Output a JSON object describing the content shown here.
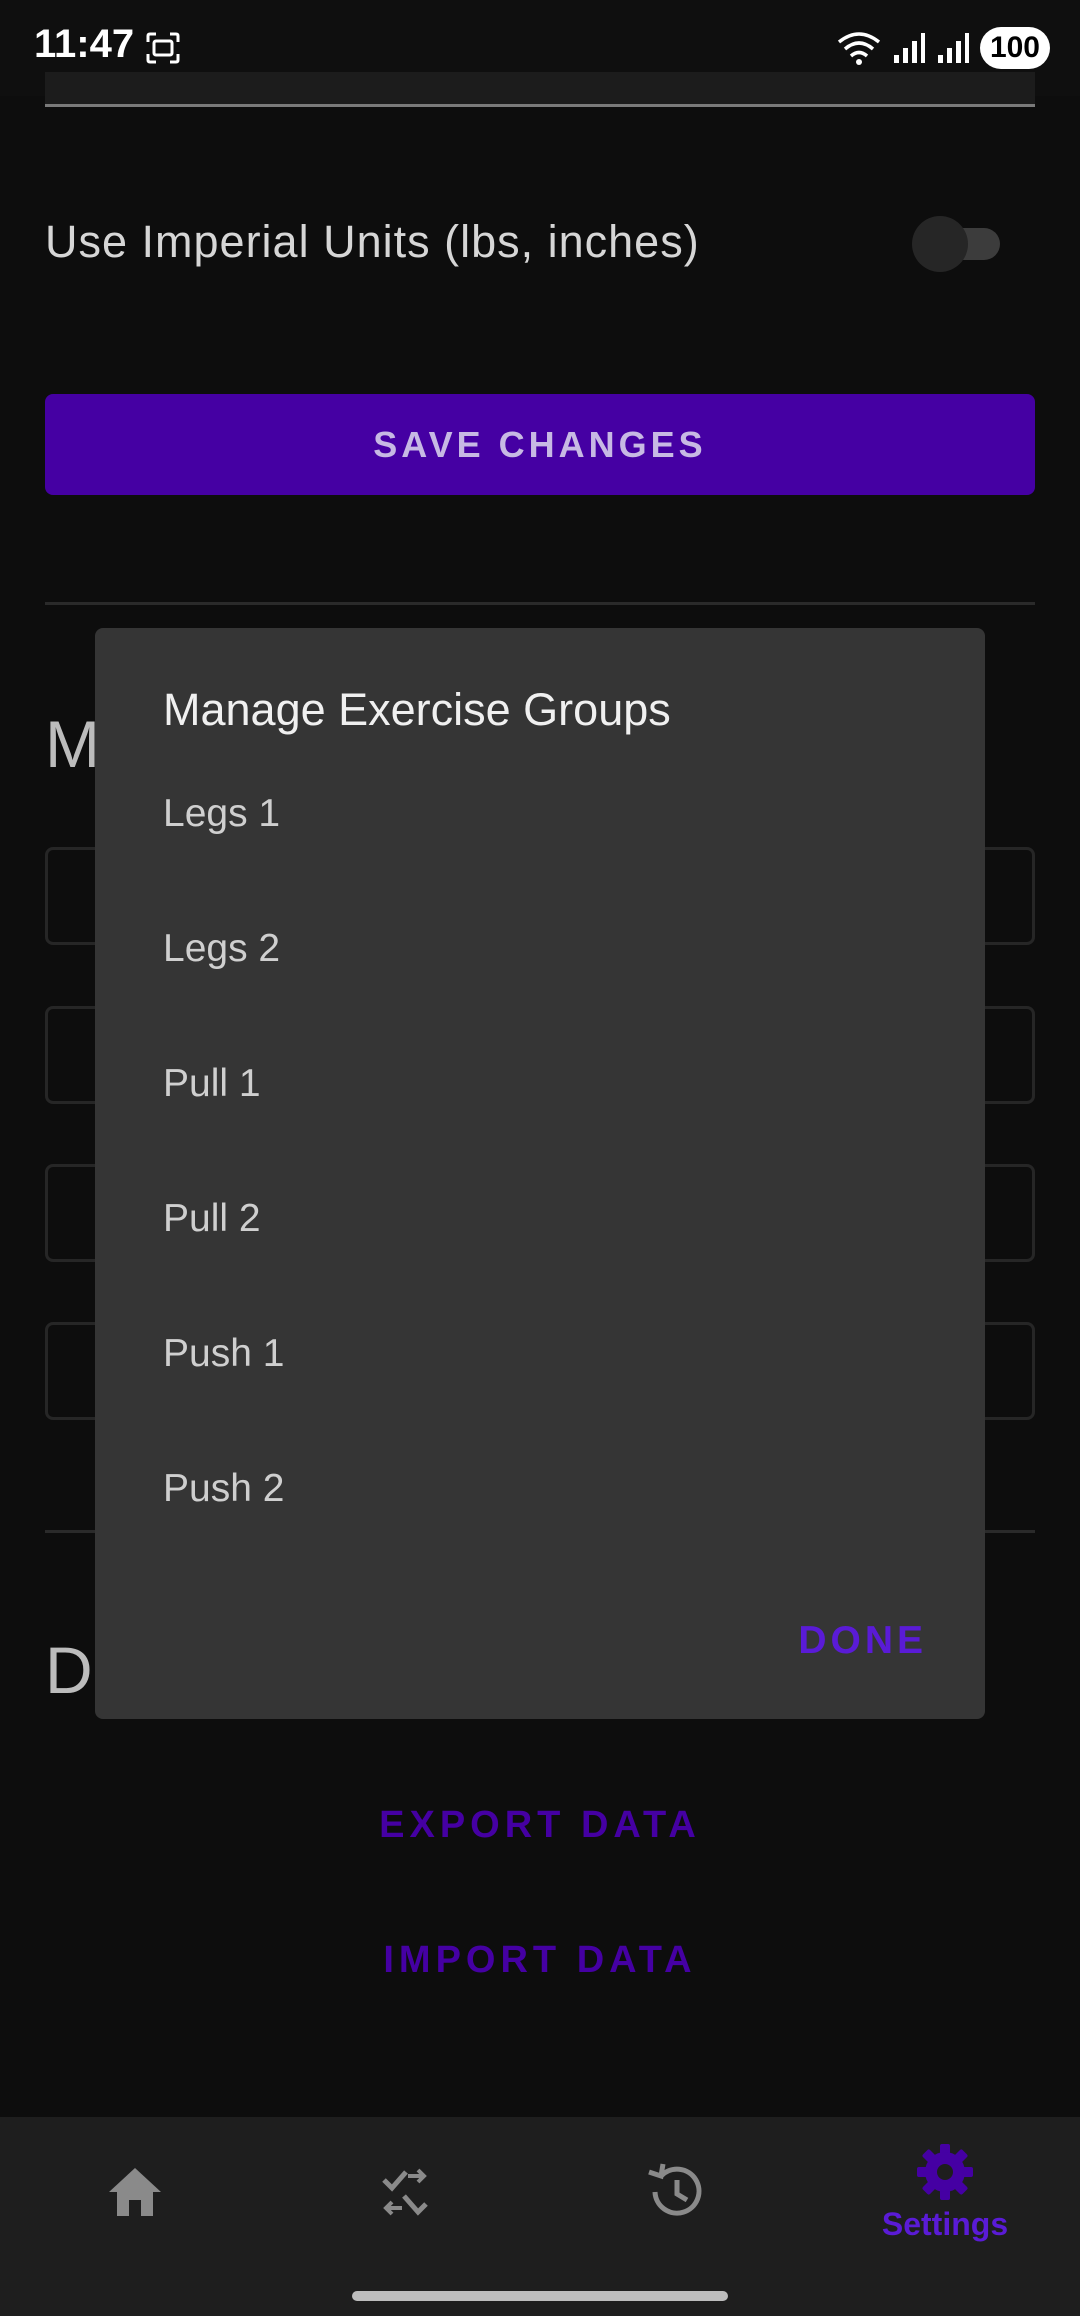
{
  "status_bar": {
    "time": "11:47",
    "battery": "100",
    "icons": [
      "screenshot-icon",
      "wifi-icon",
      "signal-icon",
      "signal-icon"
    ]
  },
  "settings": {
    "imperial_label": "Use Imperial Units (lbs, inches)",
    "imperial_enabled": false,
    "save_label": "SAVE CHANGES",
    "section_m_initial": "M",
    "section_d_initial": "D",
    "export_label": "EXPORT DATA",
    "import_label": "IMPORT DATA"
  },
  "dialog": {
    "title": "Manage Exercise Groups",
    "groups": [
      "Legs 1",
      "Legs 2",
      "Pull 1",
      "Pull 2",
      "Push 1",
      "Push 2"
    ],
    "done_label": "DONE"
  },
  "bottom_nav": {
    "items": [
      {
        "icon": "home-icon",
        "label": ""
      },
      {
        "icon": "workout-swap-icon",
        "label": ""
      },
      {
        "icon": "history-icon",
        "label": ""
      },
      {
        "icon": "settings-gear-icon",
        "label": "Settings"
      }
    ],
    "active_index": 3
  },
  "colors": {
    "accent": "#4500a3",
    "accent_text": "#5a1bd6",
    "background": "#0d0d0d",
    "dialog": "#353535"
  }
}
